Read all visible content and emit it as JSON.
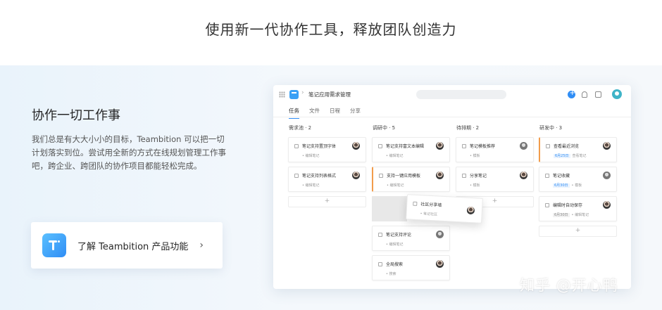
{
  "headline": "使用新一代协作工具，释放团队创造力",
  "left": {
    "title": "协作一切工作事",
    "description": "我们总是有大大小小的目标，Teambition 可以把一切计划落实到位。尝试用全新的方式在线规划管理工作事吧，跨企业、跨团队的协作项目都能轻松完成。",
    "learn_label": "了解 Teambition 产品功能",
    "learn_chevron": "›"
  },
  "app": {
    "breadcrumb_sep": "›",
    "project_name": "笔记应用需求管理",
    "tabs": [
      {
        "label": "任务",
        "active": true
      },
      {
        "label": "文件",
        "active": false
      },
      {
        "label": "日程",
        "active": false
      },
      {
        "label": "分享",
        "active": false
      }
    ],
    "add_symbol": "+",
    "columns": [
      {
        "header": "需求池 · 2",
        "cards": [
          {
            "title": "笔记支持置顶字体",
            "sub": "• 编辑笔记",
            "date": "",
            "flag": false
          },
          {
            "title": "笔记支持列表格式",
            "sub": "• 编辑笔记",
            "date": "",
            "flag": false
          }
        ]
      },
      {
        "header": "调研中 · 5",
        "cards": [
          {
            "title": "笔记支持富文本编辑",
            "sub": "• 编辑笔记",
            "date": "",
            "flag": false
          },
          {
            "title": "支持一键应用模板",
            "sub": "• 编辑笔记",
            "date": "",
            "flag": true
          },
          {
            "title": "笔记支持评论",
            "sub": "• 编辑笔记",
            "date": "",
            "flag": false
          },
          {
            "title": "全局搜索",
            "sub": "• 搜索",
            "date": "",
            "flag": false
          }
        ]
      },
      {
        "header": "待排期 · 2",
        "cards": [
          {
            "title": "笔记模板推荐",
            "sub": "• 模板",
            "date": "",
            "flag": false
          },
          {
            "title": "分享笔记",
            "sub": "• 模板",
            "date": "",
            "flag": false
          }
        ]
      },
      {
        "header": "研发中 · 3",
        "cards": [
          {
            "title": "查看最近浏览",
            "sub": "查看笔记",
            "date": "6月25日",
            "flag": true
          },
          {
            "title": "笔记收藏",
            "sub": "• 模板",
            "date": "6月30日",
            "flag": false
          },
          {
            "title": "编辑时自动保存",
            "sub": "• 编辑笔记",
            "date": "6月30日",
            "flag": false
          }
        ]
      }
    ],
    "dragging_card": {
      "title": "社区分享墙",
      "sub": "• 笔记社区"
    }
  },
  "watermark": "知乎 @开心鸭"
}
